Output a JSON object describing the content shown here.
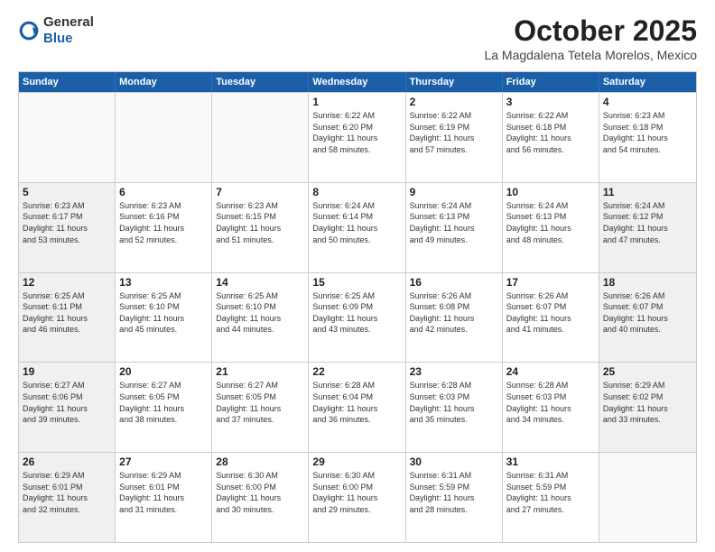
{
  "header": {
    "logo_general": "General",
    "logo_blue": "Blue",
    "month_title": "October 2025",
    "location": "La Magdalena Tetela Morelos, Mexico"
  },
  "weekdays": [
    "Sunday",
    "Monday",
    "Tuesday",
    "Wednesday",
    "Thursday",
    "Friday",
    "Saturday"
  ],
  "rows": [
    [
      {
        "day": "",
        "info": "",
        "empty": true
      },
      {
        "day": "",
        "info": "",
        "empty": true
      },
      {
        "day": "",
        "info": "",
        "empty": true
      },
      {
        "day": "1",
        "info": "Sunrise: 6:22 AM\nSunset: 6:20 PM\nDaylight: 11 hours\nand 58 minutes.",
        "empty": false
      },
      {
        "day": "2",
        "info": "Sunrise: 6:22 AM\nSunset: 6:19 PM\nDaylight: 11 hours\nand 57 minutes.",
        "empty": false
      },
      {
        "day": "3",
        "info": "Sunrise: 6:22 AM\nSunset: 6:18 PM\nDaylight: 11 hours\nand 56 minutes.",
        "empty": false
      },
      {
        "day": "4",
        "info": "Sunrise: 6:23 AM\nSunset: 6:18 PM\nDaylight: 11 hours\nand 54 minutes.",
        "empty": false
      }
    ],
    [
      {
        "day": "5",
        "info": "Sunrise: 6:23 AM\nSunset: 6:17 PM\nDaylight: 11 hours\nand 53 minutes.",
        "empty": false,
        "shaded": true
      },
      {
        "day": "6",
        "info": "Sunrise: 6:23 AM\nSunset: 6:16 PM\nDaylight: 11 hours\nand 52 minutes.",
        "empty": false
      },
      {
        "day": "7",
        "info": "Sunrise: 6:23 AM\nSunset: 6:15 PM\nDaylight: 11 hours\nand 51 minutes.",
        "empty": false
      },
      {
        "day": "8",
        "info": "Sunrise: 6:24 AM\nSunset: 6:14 PM\nDaylight: 11 hours\nand 50 minutes.",
        "empty": false
      },
      {
        "day": "9",
        "info": "Sunrise: 6:24 AM\nSunset: 6:13 PM\nDaylight: 11 hours\nand 49 minutes.",
        "empty": false
      },
      {
        "day": "10",
        "info": "Sunrise: 6:24 AM\nSunset: 6:13 PM\nDaylight: 11 hours\nand 48 minutes.",
        "empty": false
      },
      {
        "day": "11",
        "info": "Sunrise: 6:24 AM\nSunset: 6:12 PM\nDaylight: 11 hours\nand 47 minutes.",
        "empty": false,
        "shaded": true
      }
    ],
    [
      {
        "day": "12",
        "info": "Sunrise: 6:25 AM\nSunset: 6:11 PM\nDaylight: 11 hours\nand 46 minutes.",
        "empty": false,
        "shaded": true
      },
      {
        "day": "13",
        "info": "Sunrise: 6:25 AM\nSunset: 6:10 PM\nDaylight: 11 hours\nand 45 minutes.",
        "empty": false
      },
      {
        "day": "14",
        "info": "Sunrise: 6:25 AM\nSunset: 6:10 PM\nDaylight: 11 hours\nand 44 minutes.",
        "empty": false
      },
      {
        "day": "15",
        "info": "Sunrise: 6:25 AM\nSunset: 6:09 PM\nDaylight: 11 hours\nand 43 minutes.",
        "empty": false
      },
      {
        "day": "16",
        "info": "Sunrise: 6:26 AM\nSunset: 6:08 PM\nDaylight: 11 hours\nand 42 minutes.",
        "empty": false
      },
      {
        "day": "17",
        "info": "Sunrise: 6:26 AM\nSunset: 6:07 PM\nDaylight: 11 hours\nand 41 minutes.",
        "empty": false
      },
      {
        "day": "18",
        "info": "Sunrise: 6:26 AM\nSunset: 6:07 PM\nDaylight: 11 hours\nand 40 minutes.",
        "empty": false,
        "shaded": true
      }
    ],
    [
      {
        "day": "19",
        "info": "Sunrise: 6:27 AM\nSunset: 6:06 PM\nDaylight: 11 hours\nand 39 minutes.",
        "empty": false,
        "shaded": true
      },
      {
        "day": "20",
        "info": "Sunrise: 6:27 AM\nSunset: 6:05 PM\nDaylight: 11 hours\nand 38 minutes.",
        "empty": false
      },
      {
        "day": "21",
        "info": "Sunrise: 6:27 AM\nSunset: 6:05 PM\nDaylight: 11 hours\nand 37 minutes.",
        "empty": false
      },
      {
        "day": "22",
        "info": "Sunrise: 6:28 AM\nSunset: 6:04 PM\nDaylight: 11 hours\nand 36 minutes.",
        "empty": false
      },
      {
        "day": "23",
        "info": "Sunrise: 6:28 AM\nSunset: 6:03 PM\nDaylight: 11 hours\nand 35 minutes.",
        "empty": false
      },
      {
        "day": "24",
        "info": "Sunrise: 6:28 AM\nSunset: 6:03 PM\nDaylight: 11 hours\nand 34 minutes.",
        "empty": false
      },
      {
        "day": "25",
        "info": "Sunrise: 6:29 AM\nSunset: 6:02 PM\nDaylight: 11 hours\nand 33 minutes.",
        "empty": false,
        "shaded": true
      }
    ],
    [
      {
        "day": "26",
        "info": "Sunrise: 6:29 AM\nSunset: 6:01 PM\nDaylight: 11 hours\nand 32 minutes.",
        "empty": false,
        "shaded": true
      },
      {
        "day": "27",
        "info": "Sunrise: 6:29 AM\nSunset: 6:01 PM\nDaylight: 11 hours\nand 31 minutes.",
        "empty": false
      },
      {
        "day": "28",
        "info": "Sunrise: 6:30 AM\nSunset: 6:00 PM\nDaylight: 11 hours\nand 30 minutes.",
        "empty": false
      },
      {
        "day": "29",
        "info": "Sunrise: 6:30 AM\nSunset: 6:00 PM\nDaylight: 11 hours\nand 29 minutes.",
        "empty": false
      },
      {
        "day": "30",
        "info": "Sunrise: 6:31 AM\nSunset: 5:59 PM\nDaylight: 11 hours\nand 28 minutes.",
        "empty": false
      },
      {
        "day": "31",
        "info": "Sunrise: 6:31 AM\nSunset: 5:59 PM\nDaylight: 11 hours\nand 27 minutes.",
        "empty": false
      },
      {
        "day": "",
        "info": "",
        "empty": true
      }
    ]
  ]
}
